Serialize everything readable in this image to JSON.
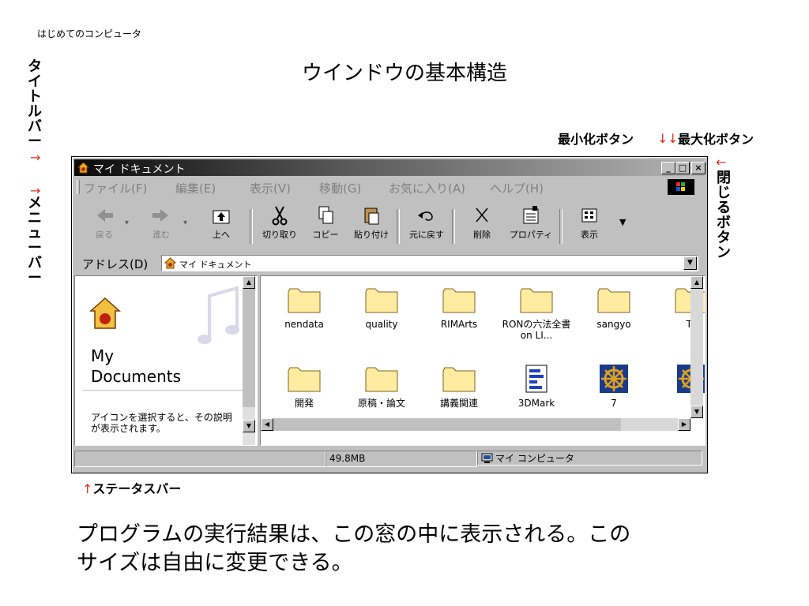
{
  "header": {
    "course": "はじめてのコンピュータ"
  },
  "slide_title": "ウインドウの基本構造",
  "annotations": {
    "titlebar_label": "タイトルバー",
    "menubar_label": "メニューバー",
    "minimize_label": "最小化ボタン",
    "maximize_label": "最大化ボタン",
    "close_label": "閉じるボタン",
    "statusbar_label": "ステータスバー",
    "arrow_right": "→",
    "arrow_down": "↓",
    "arrow_left": "←",
    "arrow_up": "↑"
  },
  "window": {
    "title": "マイ ドキュメント",
    "minimize_glyph": "_",
    "maximize_glyph": "□",
    "close_glyph": "×",
    "menu": [
      "ファイル(F)",
      "編集(E)",
      "表示(V)",
      "移動(G)",
      "お気に入り(A)",
      "ヘルプ(H)"
    ],
    "toolbar": {
      "back": "戻る",
      "forward": "進む",
      "up": "上へ",
      "cut": "切り取り",
      "copy": "コピー",
      "paste": "貼り付け",
      "undo": "元に戻す",
      "delete": "削除",
      "properties": "プロパティ",
      "view": "表示",
      "dropdown": "▼",
      "back_dropdown": "▾",
      "forward_dropdown": "▾"
    },
    "address": {
      "label": "アドレス(D)",
      "value": "マイ ドキュメント",
      "dropdown": "▼"
    },
    "left_pane": {
      "title_line1": "My",
      "title_line2": "Documents",
      "hint": "アイコンを選択すると、その説明が表示されます。"
    },
    "files": [
      {
        "name": "nendata",
        "type": "folder"
      },
      {
        "name": "quality",
        "type": "folder"
      },
      {
        "name": "RIMArts",
        "type": "folder"
      },
      {
        "name": "RONの六法全書 on LI...",
        "type": "folder"
      },
      {
        "name": "sangyo",
        "type": "folder"
      },
      {
        "name": "Ta",
        "type": "folder"
      },
      {
        "name": "開発",
        "type": "folder"
      },
      {
        "name": "原稿・論文",
        "type": "folder"
      },
      {
        "name": "講義関連",
        "type": "folder"
      },
      {
        "name": "3DMark",
        "type": "document"
      },
      {
        "name": "7",
        "type": "wheel"
      },
      {
        "name": "",
        "type": "wheel"
      }
    ],
    "scroll": {
      "up": "▲",
      "down": "▼",
      "left": "◀",
      "right": "▶"
    },
    "status": {
      "size": "49.8MB",
      "location": "マイ コンピュータ"
    }
  },
  "body_text": {
    "line1": "プログラムの実行結果は、この窓の中に表示される。この",
    "line2": "サイズは自由に変更できる。"
  },
  "colors": {
    "arrow": "#e03020",
    "folder": "#ffeca0",
    "title_dark": "#0a0a0a"
  }
}
